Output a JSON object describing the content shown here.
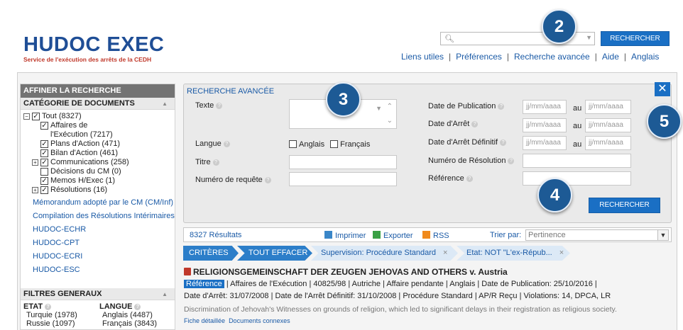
{
  "logo": {
    "part1": "HUDOC",
    "part2": "EXEC",
    "subtitle": "Service de l'exécution des arrêts de la CEDH"
  },
  "top_search": {
    "placeholder": "",
    "button": "RECHERCHER"
  },
  "top_links": [
    "Liens utiles",
    "Préférences",
    "Recherche avancée",
    "Aide",
    "Anglais"
  ],
  "left_panel": {
    "header": "AFFINER LA RECHERCHE",
    "category_header": "CATÉGORIE DE DOCUMENTS",
    "tree": {
      "root": "Tout (8327)",
      "affaires_line1": "Affaires de",
      "affaires_line2": "l'Exécution (7217)",
      "plans": "Plans d'Action (471)",
      "bilan": "Bilan d'Action (461)",
      "communications": "Communications (258)",
      "decisions": "Décisions du CM (0)",
      "memos": "Memos H/Exec (1)",
      "resolutions": "Résolutions (16)"
    },
    "links": [
      "Mémorandum adopté par le CM (CM/Inf)",
      "Compilation des Résolutions Intérimaires",
      "HUDOC-ECHR",
      "HUDOC-CPT",
      "HUDOC-ECRI",
      "HUDOC-ESC"
    ],
    "filters_header": "FILTRES GENERAUX",
    "etat": {
      "title": "ETAT",
      "items": [
        "Turquie (1978)",
        "Russie (1097)"
      ]
    },
    "langue": {
      "title": "LANGUE",
      "items": [
        "Anglais (4487)",
        "Français (3843)"
      ]
    }
  },
  "advanced": {
    "title": "RECHERCHE AVANCÉE",
    "texte": "Texte",
    "langue": "Langue",
    "anglais": "Anglais",
    "francais": "Français",
    "titre": "Titre",
    "num_requete": "Numéro de requête",
    "date_pub": "Date de Publication",
    "date_arret": "Date d'Arrêt",
    "date_def": "Date d'Arrêt Définitif",
    "num_resolution": "Numéro de Résolution",
    "reference": "Référence",
    "date_placeholder": "jj/mm/aaaa",
    "au": "au",
    "button": "RECHERCHER",
    "close": "✕"
  },
  "results_bar": {
    "count": "8327 Résultats",
    "print": "Imprimer",
    "export": "Exporter",
    "rss": "RSS",
    "sort_label": "Trier par:",
    "sort_value": "Pertinence"
  },
  "crumbs": {
    "criteres": "CRITÈRES",
    "clear": "TOUT EFFACER",
    "filter1": "Supervision: Procédure Standard",
    "filter2": "Etat: NOT \"L'ex-Répub...",
    "x": "×"
  },
  "result": {
    "title": "RELIGIONSGEMEINSCHAFT DER ZEUGEN JEHOVAS AND OTHERS v. Austria",
    "ref_badge": "Référence",
    "meta1": " |  Affaires de l'Exécution  |  40825/98  |  Autriche  |  Affaire pendante  |  Anglais  |  Date de Publication: 25/10/2016  |",
    "meta2": "Date d'Arrêt: 31/07/2008  |  Date de l'Arrêt Définitif: 31/10/2008  |  Procédure Standard  |  AP/R Reçu  |  Violations: 14, DPCA, LR",
    "desc": "Discrimination of Jehovah's Witnesses on grounds of religion, which led to significant delays in their registration as religious society.",
    "link1": "Fiche détaillée",
    "link2": "Documents connexes"
  },
  "callouts": [
    "2",
    "3",
    "4",
    "5"
  ]
}
